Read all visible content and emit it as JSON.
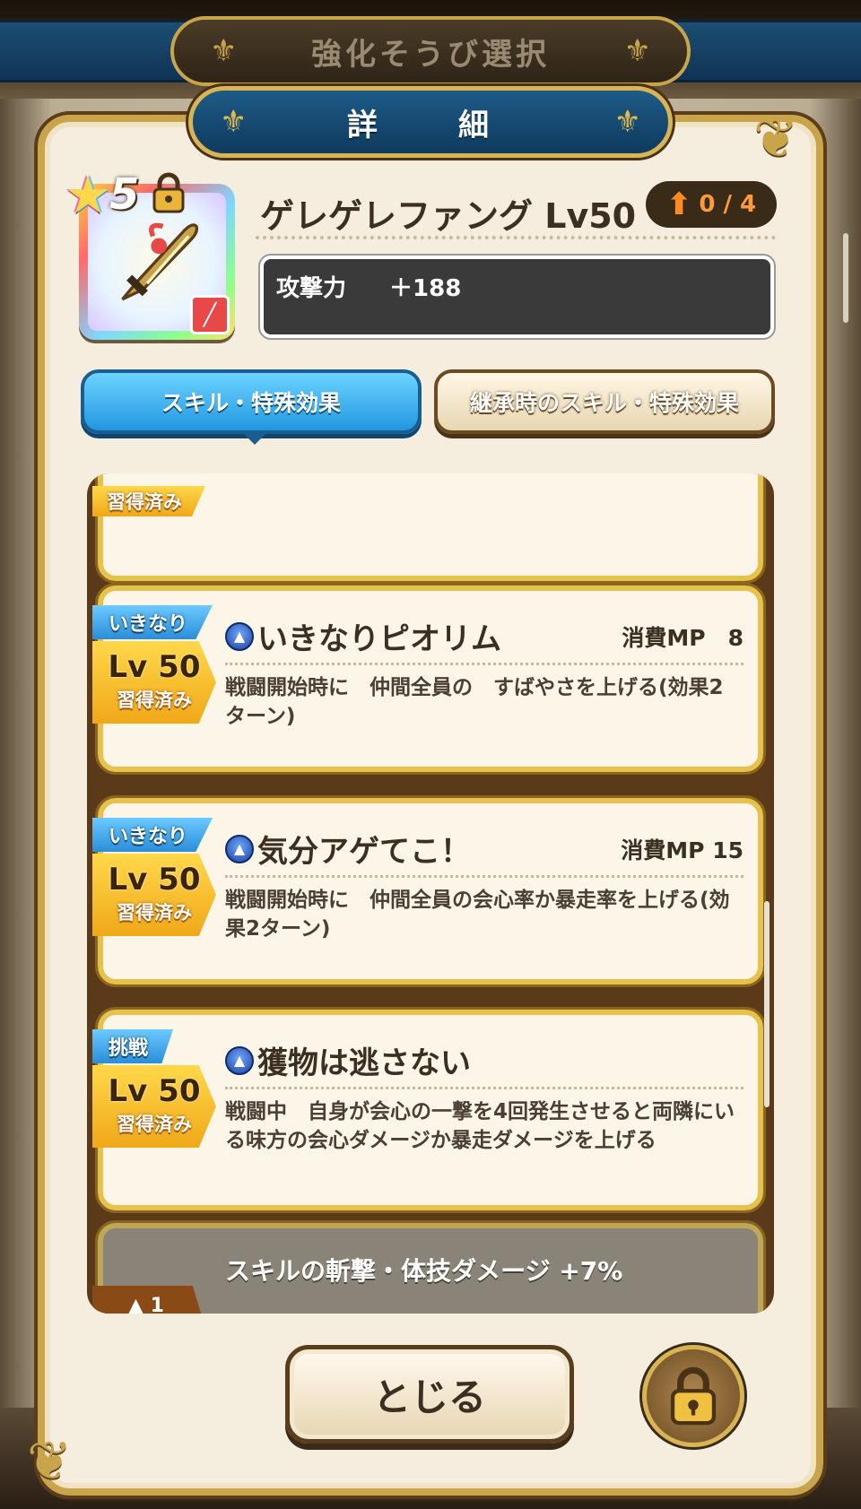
{
  "screen": {
    "title": "強化そうび選択"
  },
  "dialog": {
    "title": "詳　細",
    "item": {
      "rarity": "5",
      "name": "ゲレゲレファング Lv50",
      "upgrade": "0 / 4",
      "stat_label": "攻撃力",
      "stat_value": "＋188"
    },
    "tabs": [
      {
        "label": "スキル・特殊効果",
        "active": true
      },
      {
        "label": "継承時のスキル・特殊効果",
        "active": false
      }
    ],
    "skills": {
      "partial_tag": "習得済み",
      "cards": [
        {
          "ribbon": "いきなり",
          "level": "Lv 50",
          "status": "習得済み",
          "name": "いきなりピオリム",
          "mp": "消費MP　8",
          "desc": "戦闘開始時に　仲間全員の　すばやさを上げる(効果2ターン)"
        },
        {
          "ribbon": "いきなり",
          "level": "Lv 50",
          "status": "習得済み",
          "name": "気分アゲてこ！",
          "mp": "消費MP 15",
          "desc": "戦闘開始時に　仲間全員の会心率か暴走率を上げる(効果2ターン)"
        },
        {
          "ribbon": "挑戦",
          "level": "Lv 50",
          "status": "習得済み",
          "name": "獲物は逃さない",
          "mp": "",
          "desc": "戦闘中　自身が会心の一撃を4回発生させると両隣にいる味方の会心ダメージか暴走ダメージを上げる"
        }
      ],
      "passive": {
        "text": "スキルの斬撃・体技ダメージ +7%",
        "tab": "1"
      }
    },
    "close_label": "とじる"
  },
  "colors": {
    "accent_gold": "#c9a44a",
    "tab_active": "#2197e0",
    "header_blue": "#1e5b88"
  }
}
